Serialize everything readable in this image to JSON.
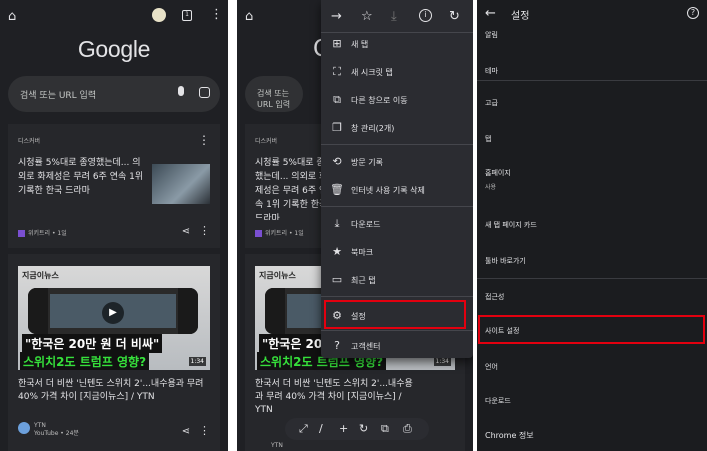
{
  "panel1": {
    "logo": "Google",
    "search_placeholder": "검색 또는 URL 입력",
    "discover_label": "디스커버",
    "feed1": {
      "text": "시청률 5%대로 종영했는데... 의외로 화제성은 무려 6주 연속 1위 기록한 한국 드라마",
      "source": "위키트리 • 1일"
    },
    "feed2": {
      "image_tag": "지금이뉴스",
      "headline1": "\"한국은 20만 원 더 비싸\"",
      "headline2": "스위치2도 트럼프 영향?",
      "duration": "1:34",
      "text": "한국서 더 비싼 '닌텐도 스위치 2'...내수용과 무려 40% 가격 차이 [지금이뉴스] / YTN",
      "channel": "YTN",
      "channel_meta": "YouTube • 24분"
    }
  },
  "panel2": {
    "bg_discover": "디스커버",
    "bg_feed_text": "시청률 5%대로 종영했는데... 의외로 화제성은 무려 6주 연속 1위 기록한 한국 드라마",
    "bg_source": "위키트리 • 1일",
    "bg_image_tag": "지금이뉴스",
    "bg_headline1": "\"한국은 20만 원 더 비싸\"",
    "bg_headline2": "스위치2도 트럼프 영향?",
    "bg_duration": "1:34",
    "bg_news_text": "한국서 더 비싼 '닌텐도 스위치 2'...내수용과 무려 40% 가격 차이 [지금이뉴스] / YTN",
    "bg_channel": "YTN",
    "bg_search": "검색 또는 URL 입력",
    "menu_items": [
      {
        "icon": "plus-box-icon",
        "glyph": "⊞",
        "label": "새 탭"
      },
      {
        "icon": "incognito-icon",
        "glyph": "⛶",
        "label": "새 시크릿 탭"
      },
      {
        "icon": "move-window-icon",
        "glyph": "⧉",
        "label": "다른 창으로 이동"
      },
      {
        "icon": "window-manage-icon",
        "glyph": "❐",
        "label": "창 관리(2개)"
      },
      {
        "icon": "history-icon",
        "glyph": "⟲",
        "label": "방문 기록"
      },
      {
        "icon": "trash-icon",
        "glyph": "🗑",
        "label": "인터넷 사용 기록 삭제"
      },
      {
        "icon": "download-icon",
        "glyph": "⤓",
        "label": "다운로드"
      },
      {
        "icon": "star-icon",
        "glyph": "★",
        "label": "북마크"
      },
      {
        "icon": "recent-tabs-icon",
        "glyph": "▭",
        "label": "최근 탭"
      },
      {
        "icon": "gear-icon",
        "glyph": "⚙",
        "label": "설정"
      },
      {
        "icon": "help-icon",
        "glyph": "?",
        "label": "고객센터"
      }
    ]
  },
  "panel3": {
    "title": "설정",
    "items": [
      "알림",
      "테마",
      "고급",
      "탭",
      "홈페이지",
      "사용",
      "새 탭 페이지 카드",
      "툴바 바로가기",
      "접근성",
      "사이트 설정",
      "언어",
      "다운로드",
      "Chrome 정보"
    ]
  },
  "colors": {
    "highlight_box": "#e3000f",
    "headline_green": "#36e03b",
    "background": "#1f2024"
  }
}
